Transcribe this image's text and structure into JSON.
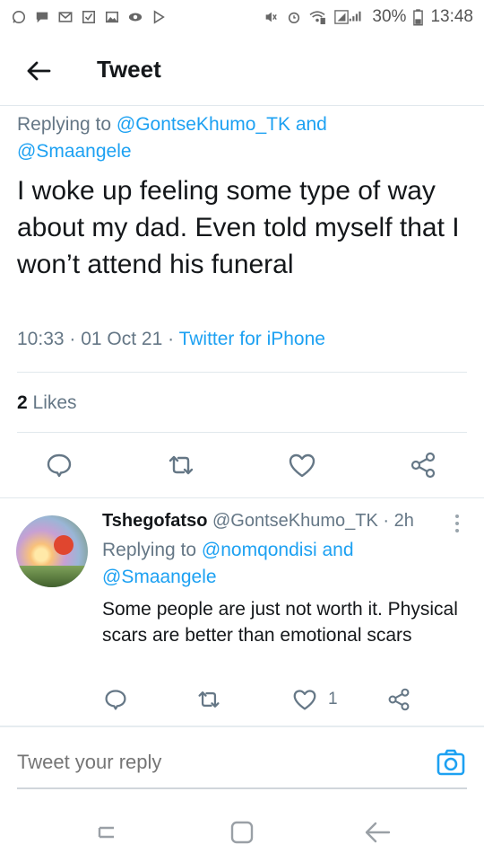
{
  "status_bar": {
    "battery": "30%",
    "time": "13:48",
    "left_icons": [
      "whatsapp-icon",
      "chat-icon",
      "gmail-icon",
      "checkbox-icon",
      "image-icon",
      "eye-icon",
      "play-store-icon"
    ],
    "right_icons": [
      "mute-icon",
      "alarm-icon",
      "wifi-icon",
      "signal-icon",
      "battery-icon"
    ]
  },
  "header": {
    "back_icon": "arrow-left-icon",
    "title": "Tweet"
  },
  "tweet": {
    "replying_prefix": "Replying to ",
    "replying_user1": "@GontseKhumo_TK",
    "replying_and": " and",
    "replying_user2": "@Smaangele",
    "text": "I woke up feeling some type of way about my dad. Even told myself that I won’t attend his funeral",
    "timestamp": "10:33 · 01 Oct 21 · ",
    "source": "Twitter for iPhone",
    "likes_count": "2",
    "likes_label": " Likes",
    "actions": [
      "reply-icon",
      "retweet-icon",
      "like-icon",
      "share-icon"
    ]
  },
  "reply": {
    "name": "Tshegofatso",
    "handle_time": " @GontseKhumo_TK · 2h",
    "replying_prefix": "Replying to ",
    "replying_user1": "@nomqondisi",
    "replying_and": " and",
    "replying_user2": "@Smaangele",
    "text": "Some people are just not worth it. Physical scars are better than emotional scars",
    "like_count": "1"
  },
  "compose": {
    "placeholder": "Tweet your reply"
  },
  "colors": {
    "accent": "#1da1f2",
    "muted": "#657786",
    "text": "#14171a"
  }
}
